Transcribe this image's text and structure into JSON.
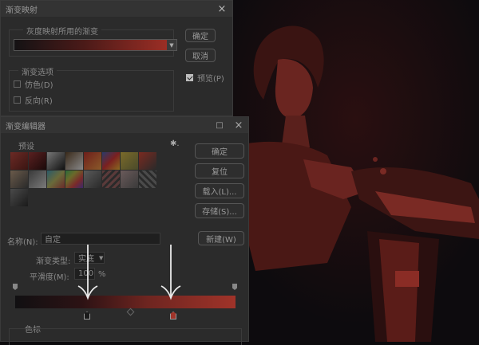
{
  "dialog1": {
    "title": "渐变映射",
    "group_label": "灰度映射所用的渐变",
    "options_label": "渐变选项",
    "dither_label": "仿色(D)",
    "reverse_label": "反向(R)",
    "ok_label": "确定",
    "cancel_label": "取消",
    "preview_label": "预览(P)",
    "close": "×"
  },
  "dialog2": {
    "title": "渐变编辑器",
    "presets_label": "预设",
    "gear": "✱.",
    "ok_label": "确定",
    "reset_label": "复位",
    "load_label": "载入(L)...",
    "save_label": "存储(S)...",
    "name_label": "名称(N):",
    "name_value": "自定",
    "new_label": "新建(W)",
    "type_label": "渐变类型:",
    "type_value": "实底",
    "smooth_label": "平滑度(M):",
    "smooth_value": "100",
    "smooth_unit": "%",
    "color_stop_label": "色标",
    "close": "×",
    "maximize": "□"
  },
  "colors": {
    "gradient_start": "#111012",
    "gradient_end": "#a03329",
    "accent_red": "#a03329"
  }
}
